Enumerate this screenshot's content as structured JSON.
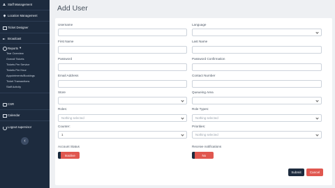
{
  "sidebar": {
    "items": [
      {
        "label": "Staff Management",
        "icon": "user-icon"
      },
      {
        "label": "Location Management",
        "icon": "location-icon"
      },
      {
        "label": "Ticket Designer",
        "icon": "ticket-icon"
      },
      {
        "label": "Broadcast",
        "icon": "broadcast-icon"
      },
      {
        "label": "Reports",
        "icon": "reports-icon"
      },
      {
        "label": "CSR",
        "icon": "csr-icon"
      },
      {
        "label": "Calendar",
        "icon": "calendar-icon"
      },
      {
        "label": "Logout supervisor",
        "icon": "logout-icon"
      }
    ],
    "reports_caret": "▾",
    "report_subitems": [
      "Tear Overview",
      "Overall Tickets",
      "Tickets Per Service",
      "Tickets Per Hour",
      "Appointments/Bookings",
      "Ticket Transactions",
      "Staff Activity"
    ],
    "collapse_glyph": "‹"
  },
  "page": {
    "title": "Add User"
  },
  "form": {
    "username": {
      "label": "Username",
      "value": ""
    },
    "language": {
      "label": "Language",
      "value": ""
    },
    "first_name": {
      "label": "First Name",
      "value": ""
    },
    "last_name": {
      "label": "Last Name",
      "value": ""
    },
    "password": {
      "label": "Password",
      "value": ""
    },
    "password_confirmation": {
      "label": "Password Confirmation",
      "value": ""
    },
    "email": {
      "label": "Email Address",
      "value": ""
    },
    "contact_number": {
      "label": "Contact Number",
      "value": ""
    },
    "store": {
      "label": "Store",
      "value": ""
    },
    "queueing_area": {
      "label": "Queueing Area",
      "value": ""
    },
    "roles": {
      "label": "Roles:",
      "placeholder": "Nothing selected"
    },
    "role_types": {
      "label": "Role Types:",
      "placeholder": "Nothing selected"
    },
    "counter": {
      "label": "Counter:",
      "value": "1"
    },
    "priorities": {
      "label": "Priorities:",
      "placeholder": "Nothing selected"
    },
    "account_status": {
      "label": "Account Status",
      "state": "Inactive"
    },
    "receive_notifications": {
      "label": "Receive notifications",
      "state": "No"
    }
  },
  "actions": {
    "submit": "Submit",
    "cancel": "Cancel"
  },
  "colors": {
    "sidebar": "#1d2b3e",
    "danger": "#e0574f",
    "background": "#eef0f3"
  }
}
